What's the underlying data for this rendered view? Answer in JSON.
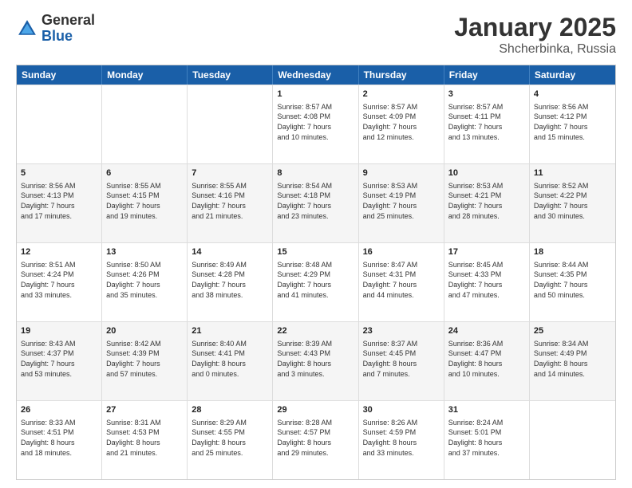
{
  "logo": {
    "general": "General",
    "blue": "Blue"
  },
  "title": {
    "month": "January 2025",
    "location": "Shcherbinka, Russia"
  },
  "header": {
    "days": [
      "Sunday",
      "Monday",
      "Tuesday",
      "Wednesday",
      "Thursday",
      "Friday",
      "Saturday"
    ]
  },
  "rows": [
    [
      {
        "day": "",
        "text": ""
      },
      {
        "day": "",
        "text": ""
      },
      {
        "day": "",
        "text": ""
      },
      {
        "day": "1",
        "text": "Sunrise: 8:57 AM\nSunset: 4:08 PM\nDaylight: 7 hours\nand 10 minutes."
      },
      {
        "day": "2",
        "text": "Sunrise: 8:57 AM\nSunset: 4:09 PM\nDaylight: 7 hours\nand 12 minutes."
      },
      {
        "day": "3",
        "text": "Sunrise: 8:57 AM\nSunset: 4:11 PM\nDaylight: 7 hours\nand 13 minutes."
      },
      {
        "day": "4",
        "text": "Sunrise: 8:56 AM\nSunset: 4:12 PM\nDaylight: 7 hours\nand 15 minutes."
      }
    ],
    [
      {
        "day": "5",
        "text": "Sunrise: 8:56 AM\nSunset: 4:13 PM\nDaylight: 7 hours\nand 17 minutes."
      },
      {
        "day": "6",
        "text": "Sunrise: 8:55 AM\nSunset: 4:15 PM\nDaylight: 7 hours\nand 19 minutes."
      },
      {
        "day": "7",
        "text": "Sunrise: 8:55 AM\nSunset: 4:16 PM\nDaylight: 7 hours\nand 21 minutes."
      },
      {
        "day": "8",
        "text": "Sunrise: 8:54 AM\nSunset: 4:18 PM\nDaylight: 7 hours\nand 23 minutes."
      },
      {
        "day": "9",
        "text": "Sunrise: 8:53 AM\nSunset: 4:19 PM\nDaylight: 7 hours\nand 25 minutes."
      },
      {
        "day": "10",
        "text": "Sunrise: 8:53 AM\nSunset: 4:21 PM\nDaylight: 7 hours\nand 28 minutes."
      },
      {
        "day": "11",
        "text": "Sunrise: 8:52 AM\nSunset: 4:22 PM\nDaylight: 7 hours\nand 30 minutes."
      }
    ],
    [
      {
        "day": "12",
        "text": "Sunrise: 8:51 AM\nSunset: 4:24 PM\nDaylight: 7 hours\nand 33 minutes."
      },
      {
        "day": "13",
        "text": "Sunrise: 8:50 AM\nSunset: 4:26 PM\nDaylight: 7 hours\nand 35 minutes."
      },
      {
        "day": "14",
        "text": "Sunrise: 8:49 AM\nSunset: 4:28 PM\nDaylight: 7 hours\nand 38 minutes."
      },
      {
        "day": "15",
        "text": "Sunrise: 8:48 AM\nSunset: 4:29 PM\nDaylight: 7 hours\nand 41 minutes."
      },
      {
        "day": "16",
        "text": "Sunrise: 8:47 AM\nSunset: 4:31 PM\nDaylight: 7 hours\nand 44 minutes."
      },
      {
        "day": "17",
        "text": "Sunrise: 8:45 AM\nSunset: 4:33 PM\nDaylight: 7 hours\nand 47 minutes."
      },
      {
        "day": "18",
        "text": "Sunrise: 8:44 AM\nSunset: 4:35 PM\nDaylight: 7 hours\nand 50 minutes."
      }
    ],
    [
      {
        "day": "19",
        "text": "Sunrise: 8:43 AM\nSunset: 4:37 PM\nDaylight: 7 hours\nand 53 minutes."
      },
      {
        "day": "20",
        "text": "Sunrise: 8:42 AM\nSunset: 4:39 PM\nDaylight: 7 hours\nand 57 minutes."
      },
      {
        "day": "21",
        "text": "Sunrise: 8:40 AM\nSunset: 4:41 PM\nDaylight: 8 hours\nand 0 minutes."
      },
      {
        "day": "22",
        "text": "Sunrise: 8:39 AM\nSunset: 4:43 PM\nDaylight: 8 hours\nand 3 minutes."
      },
      {
        "day": "23",
        "text": "Sunrise: 8:37 AM\nSunset: 4:45 PM\nDaylight: 8 hours\nand 7 minutes."
      },
      {
        "day": "24",
        "text": "Sunrise: 8:36 AM\nSunset: 4:47 PM\nDaylight: 8 hours\nand 10 minutes."
      },
      {
        "day": "25",
        "text": "Sunrise: 8:34 AM\nSunset: 4:49 PM\nDaylight: 8 hours\nand 14 minutes."
      }
    ],
    [
      {
        "day": "26",
        "text": "Sunrise: 8:33 AM\nSunset: 4:51 PM\nDaylight: 8 hours\nand 18 minutes."
      },
      {
        "day": "27",
        "text": "Sunrise: 8:31 AM\nSunset: 4:53 PM\nDaylight: 8 hours\nand 21 minutes."
      },
      {
        "day": "28",
        "text": "Sunrise: 8:29 AM\nSunset: 4:55 PM\nDaylight: 8 hours\nand 25 minutes."
      },
      {
        "day": "29",
        "text": "Sunrise: 8:28 AM\nSunset: 4:57 PM\nDaylight: 8 hours\nand 29 minutes."
      },
      {
        "day": "30",
        "text": "Sunrise: 8:26 AM\nSunset: 4:59 PM\nDaylight: 8 hours\nand 33 minutes."
      },
      {
        "day": "31",
        "text": "Sunrise: 8:24 AM\nSunset: 5:01 PM\nDaylight: 8 hours\nand 37 minutes."
      },
      {
        "day": "",
        "text": ""
      }
    ]
  ]
}
